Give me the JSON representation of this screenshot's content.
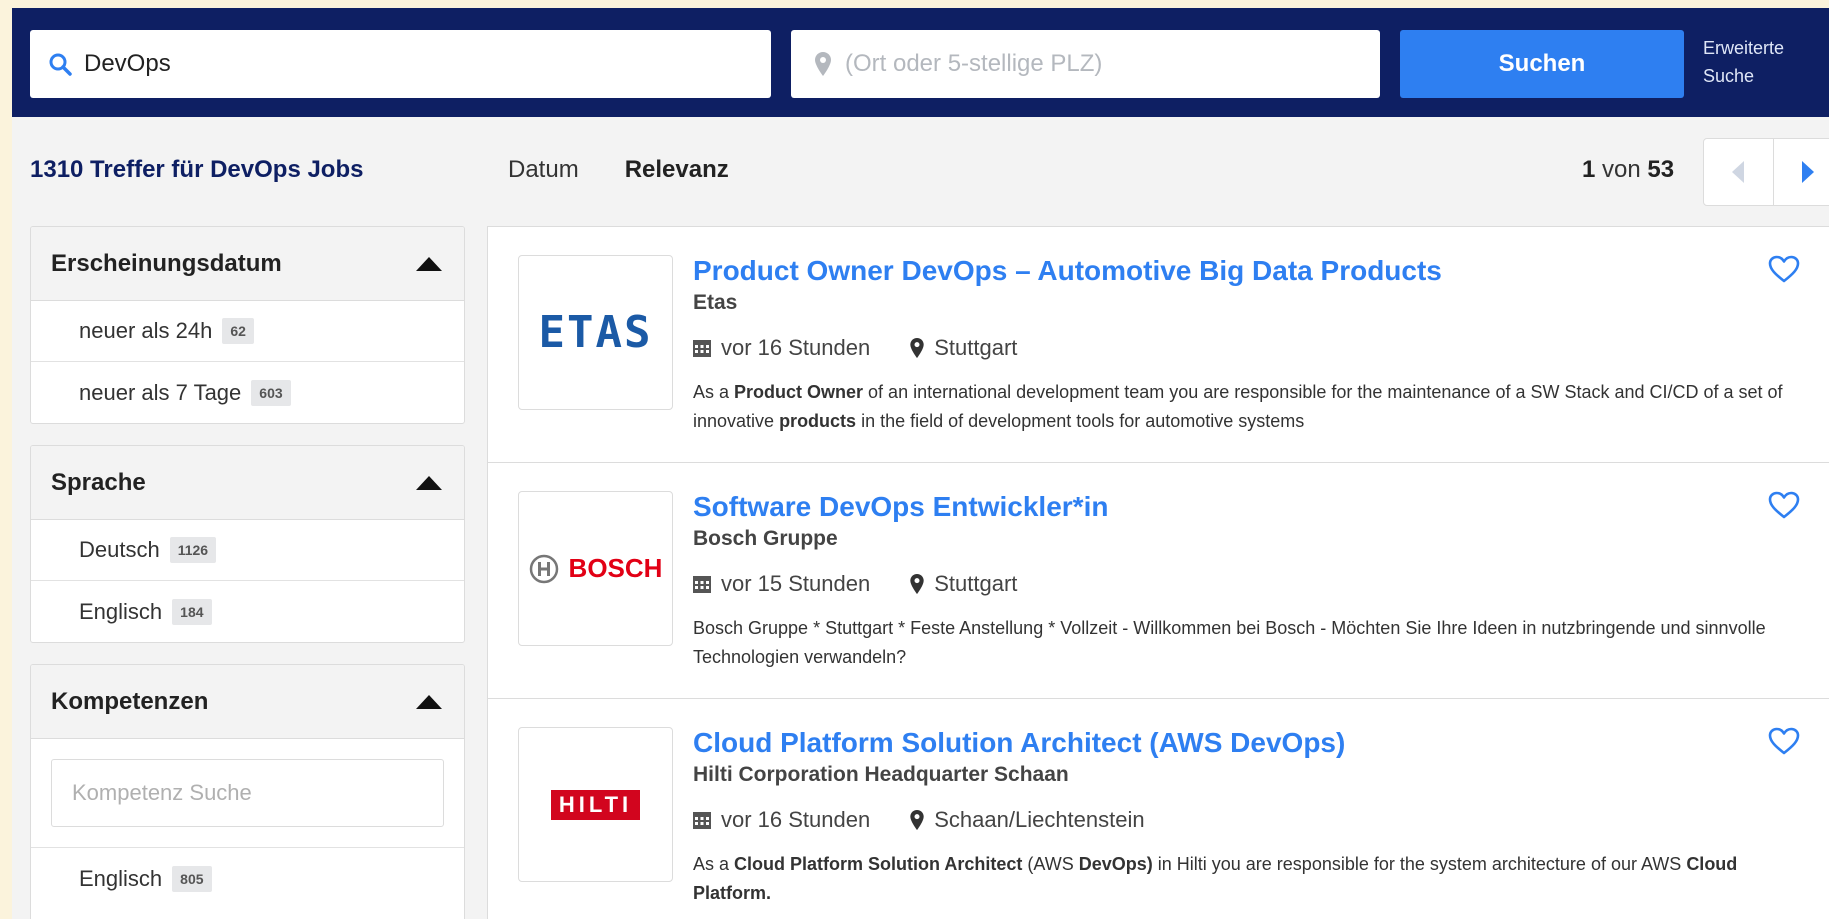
{
  "header": {
    "search_what_value": "DevOps",
    "search_where_placeholder": "(Ort oder 5-stellige PLZ)",
    "search_button": "Suchen",
    "advanced_line1": "Erweiterte",
    "advanced_line2": "Suche"
  },
  "results_header": {
    "hits_title": "1310 Treffer für DevOps Jobs",
    "sort_tabs": [
      "Datum",
      "Relevanz"
    ],
    "active_sort": "Relevanz",
    "page_current": "1",
    "page_of": "von",
    "page_total": "53"
  },
  "facets": {
    "date": {
      "title": "Erscheinungsdatum",
      "items": [
        {
          "label": "neuer als 24h",
          "count": "62"
        },
        {
          "label": "neuer als 7 Tage",
          "count": "603"
        }
      ]
    },
    "language": {
      "title": "Sprache",
      "items": [
        {
          "label": "Deutsch",
          "count": "1126"
        },
        {
          "label": "Englisch",
          "count": "184"
        }
      ]
    },
    "skills": {
      "title": "Kompetenzen",
      "search_placeholder": "Kompetenz Suche",
      "items": [
        {
          "label": "Englisch",
          "count": "805"
        }
      ]
    }
  },
  "jobs": [
    {
      "title": "Product Owner DevOps – Automotive Big Data Products",
      "company": "Etas",
      "posted": "vor 16 Stunden",
      "location": "Stuttgart",
      "logo_text": "ETAS",
      "logo_color": "#1b5aa6",
      "desc": [
        {
          "t": "As a ",
          "b": false
        },
        {
          "t": "Product Owner",
          "b": true
        },
        {
          "t": " of an international development team you are responsible for the maintenance of a SW Stack and CI/CD of a set of innovative ",
          "b": false
        },
        {
          "t": "products",
          "b": true
        },
        {
          "t": " in the field of development tools for automotive systems",
          "b": false
        }
      ]
    },
    {
      "title": "Software DevOps Entwickler*in",
      "company": "Bosch Gruppe",
      "posted": "vor 15 Stunden",
      "location": "Stuttgart",
      "logo_text": "BOSCH",
      "logo_color": "#e20015",
      "desc": [
        {
          "t": "Bosch Gruppe * Stuttgart * Feste Anstellung * Vollzeit - Willkommen bei Bosch - Möchten Sie Ihre Ideen in nutzbringende und sinnvolle Technologien verwandeln?",
          "b": false
        }
      ]
    },
    {
      "title": "Cloud Platform Solution Architect (AWS DevOps)",
      "company": "Hilti Corporation Headquarter Schaan",
      "posted": "vor 16 Stunden",
      "location": "Schaan/Liechtenstein",
      "logo_text": "HILTI",
      "logo_color": "#d2051e",
      "desc": [
        {
          "t": "As a ",
          "b": false
        },
        {
          "t": "Cloud Platform Solution Architect",
          "b": true
        },
        {
          "t": " (AWS ",
          "b": false
        },
        {
          "t": "DevOps)",
          "b": true
        },
        {
          "t": " in Hilti you are responsible for the system architecture of our AWS ",
          "b": false
        },
        {
          "t": "Cloud Platform.",
          "b": true
        }
      ]
    }
  ],
  "colors": {
    "header_bg": "#0e1f63",
    "accent": "#2e7ff1"
  }
}
